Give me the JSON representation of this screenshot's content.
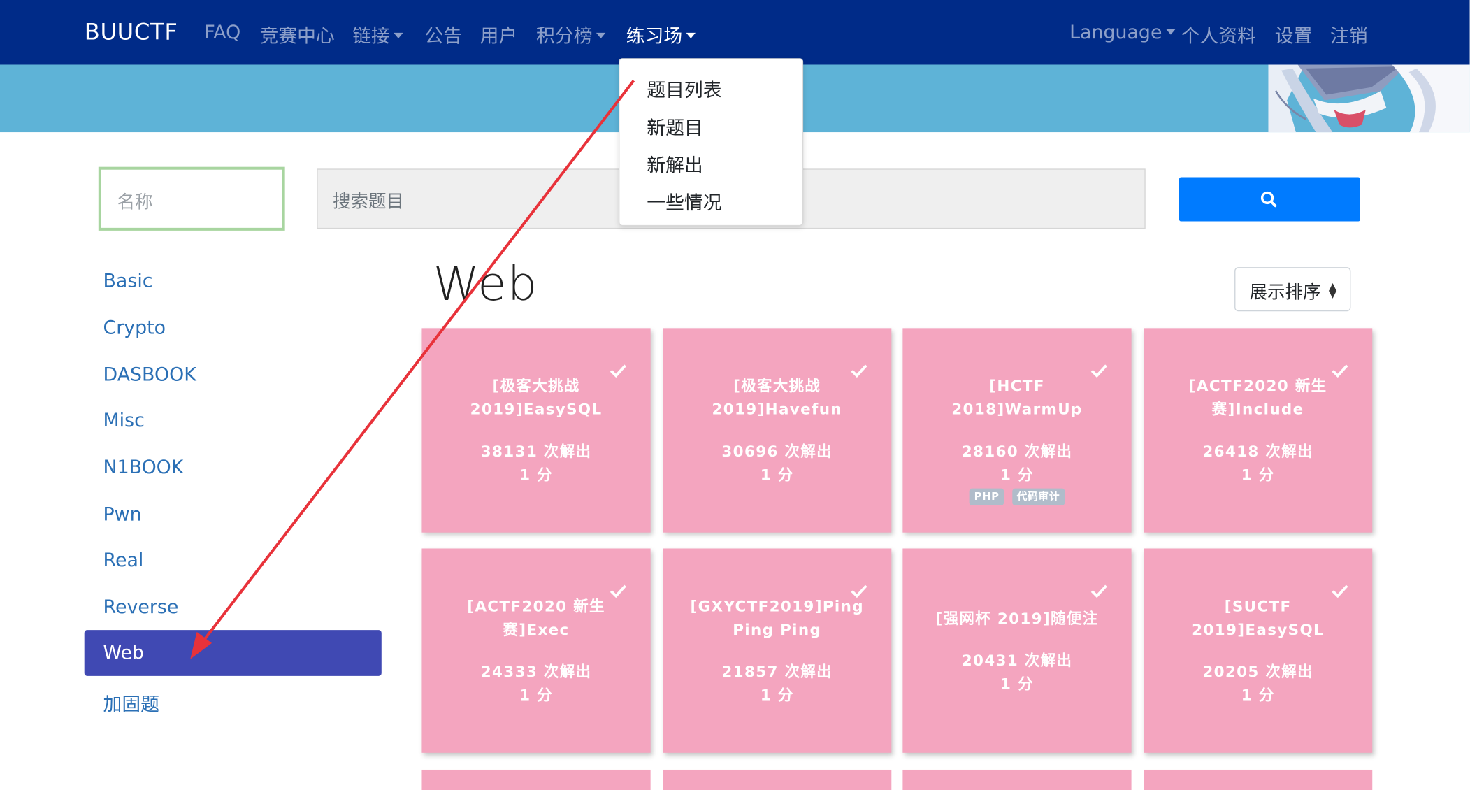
{
  "navbar": {
    "brand": "BUUCTF",
    "left_items": [
      {
        "label": "FAQ"
      },
      {
        "label": "竞赛中心"
      },
      {
        "label": "链接"
      },
      {
        "label": "公告"
      },
      {
        "label": "用户"
      },
      {
        "label": "积分榜"
      },
      {
        "label": "练习场"
      }
    ],
    "right_items": [
      {
        "label": "Language"
      },
      {
        "label": "个人资料"
      },
      {
        "label": "设置"
      },
      {
        "label": "注销"
      }
    ]
  },
  "dropdown": {
    "items": [
      {
        "label": "题目列表"
      },
      {
        "label": "新题目"
      },
      {
        "label": "新解出"
      },
      {
        "label": "一些情况"
      }
    ]
  },
  "search": {
    "name_placeholder": "名称",
    "query_placeholder": "搜索题目"
  },
  "categories": [
    {
      "label": "Basic"
    },
    {
      "label": "Crypto"
    },
    {
      "label": "DASBOOK"
    },
    {
      "label": "Misc"
    },
    {
      "label": "N1BOOK"
    },
    {
      "label": "Pwn"
    },
    {
      "label": "Real"
    },
    {
      "label": "Reverse"
    },
    {
      "label": "Web",
      "active": true
    },
    {
      "label": "加固题"
    }
  ],
  "section": {
    "title": "Web",
    "sort_label": "展示排序"
  },
  "challenges": [
    {
      "title": "[极客大挑战 2019]EasySQL",
      "solves": "38131 次解出",
      "points": "1 分",
      "solved": true
    },
    {
      "title": "[极客大挑战 2019]Havefun",
      "solves": "30696 次解出",
      "points": "1 分",
      "solved": true
    },
    {
      "title": "[HCTF 2018]WarmUp",
      "solves": "28160 次解出",
      "points": "1 分",
      "solved": true,
      "tags": [
        "PHP",
        "代码审计"
      ]
    },
    {
      "title": "[ACTF2020 新生赛]Include",
      "solves": "26418 次解出",
      "points": "1 分",
      "solved": true
    },
    {
      "title": "[ACTF2020 新生赛]Exec",
      "solves": "24333 次解出",
      "points": "1 分",
      "solved": true
    },
    {
      "title": "[GXYCTF2019]Ping Ping Ping",
      "solves": "21857 次解出",
      "points": "1 分",
      "solved": true
    },
    {
      "title": "[强网杯 2019]随便注",
      "solves": "20431 次解出",
      "points": "1 分",
      "solved": true
    },
    {
      "title": "[SUCTF 2019]EasySQL",
      "solves": "20205 次解出",
      "points": "1 分",
      "solved": true
    }
  ],
  "colors": {
    "navbar": "#002b88",
    "banner": "#5eb3d7",
    "card": "#f4a5bf",
    "active_category": "#4049b3",
    "search_button": "#007bff",
    "annotation_arrow": "#e8323a"
  },
  "icons": {
    "search_button": "search-icon",
    "solved_marker": "checkmark-icon",
    "sort": "sort-updown-icon"
  }
}
